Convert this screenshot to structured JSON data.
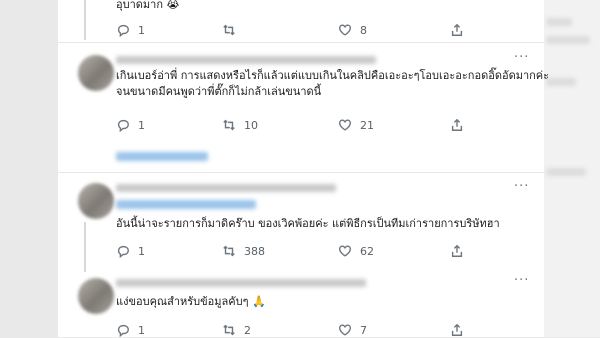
{
  "tweets": [
    {
      "text_lines": [
        "อุบาดมาก 😭"
      ],
      "stats": {
        "replies": "1",
        "retweets": "",
        "likes": "8"
      }
    },
    {
      "text_lines": [
        "เกินเบอร์อ่าพี่ การแสดงหรือไรก็แล้วแต่แบบเกินในคลิปคือเอะอะๆโอบเอะอะกอดอิ๊ดอัดมากค่ะ",
        "จนขนาดมีคนพูดว่าพี่ตั๊กก็ไม่กล้าเล่นขนาดนี้"
      ],
      "stats": {
        "replies": "1",
        "retweets": "10",
        "likes": "21"
      }
    },
    {
      "text_lines": [
        "อันนี้น่าจะรายการก็มาดิคร๊าบ ของเวิคพ้อยค่ะ แต่พิธีกรเป็นทีมเก่ารายการบริษัทฮา"
      ],
      "stats": {
        "replies": "1",
        "retweets": "388",
        "likes": "62"
      }
    },
    {
      "text_lines": [
        "แง่ขอบคุณสำหรับข้อมูลคับๆ 🙏"
      ],
      "stats": {
        "replies": "1",
        "retweets": "2",
        "likes": "7"
      }
    }
  ],
  "icons": [
    "reply-icon",
    "retweet-icon",
    "like-icon",
    "share-icon",
    "more-icon"
  ],
  "colors": {
    "icon_gray": "#6e767d",
    "link_blue": "#9cc4ea",
    "background": "#ffffff"
  }
}
